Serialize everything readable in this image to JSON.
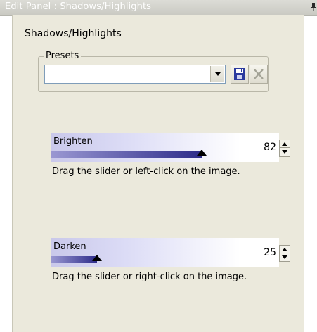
{
  "window": {
    "title": "Edit Panel : Shadows/Highlights"
  },
  "panel": {
    "heading": "Shadows/Highlights",
    "presets": {
      "legend": "Presets",
      "combo_value": "",
      "icons": {
        "dropdown": "chevron-down-icon",
        "save": "floppy-disk-icon",
        "delete": "close-icon"
      }
    }
  },
  "sliders": [
    {
      "label": "Brighten",
      "value": "82",
      "max": 100,
      "hint": "Drag the slider or left-click on the image."
    },
    {
      "label": "Darken",
      "value": "25",
      "max": 100,
      "hint": "Drag the slider or right-click on the image."
    }
  ],
  "colors": {
    "track_start": "#9a98d2",
    "track_end": "#2e2c8a",
    "panel_bg": "#ebe9dc",
    "accent_blue": "#2b3a9e"
  }
}
